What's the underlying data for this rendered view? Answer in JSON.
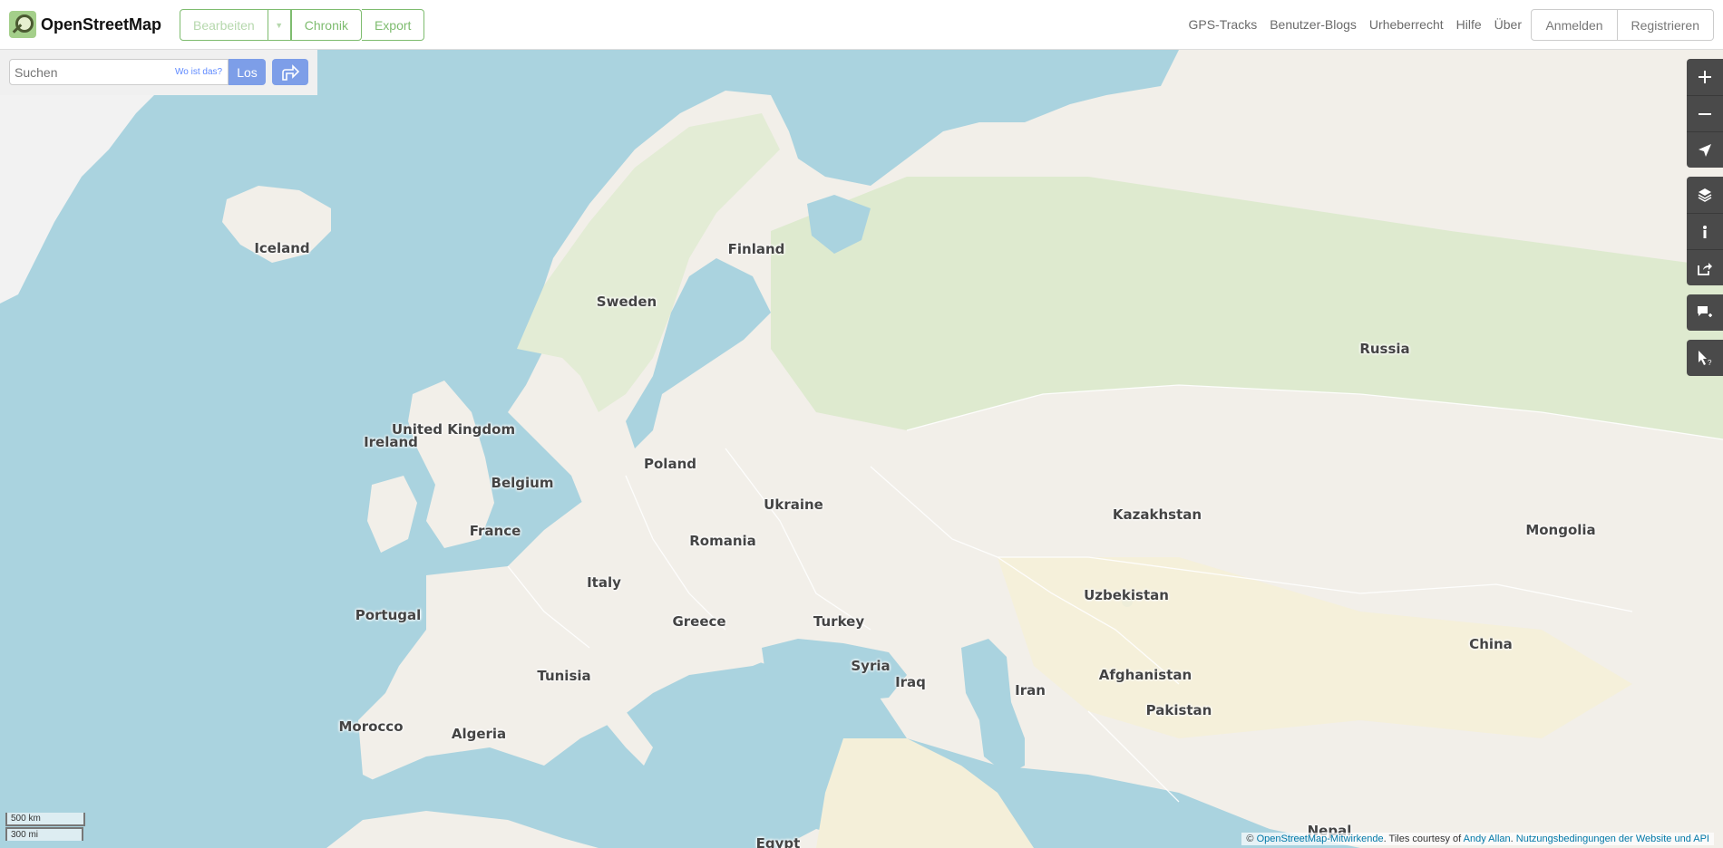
{
  "app": {
    "name": "OpenStreetMap"
  },
  "header": {
    "edit_label": "Bearbeiten",
    "history_label": "Chronik",
    "export_label": "Export",
    "nav": [
      "GPS-Tracks",
      "Benutzer-Blogs",
      "Urheberrecht",
      "Hilfe",
      "Über"
    ],
    "login_label": "Anmelden",
    "register_label": "Registrieren"
  },
  "search": {
    "placeholder": "Suchen",
    "where_label": "Wo ist das?",
    "go_label": "Los",
    "directions_icon": "directions-icon"
  },
  "controls": [
    "zoom-in-icon",
    "zoom-out-icon",
    "locate-icon",
    "layers-icon",
    "info-icon",
    "share-icon",
    "add-note-icon",
    "query-features-icon"
  ],
  "map": {
    "labels": {
      "iceland": "Iceland",
      "finland": "Finland",
      "sweden": "Sweden",
      "russia": "Russia",
      "united_kingdom": "United Kingdom",
      "ireland": "Ireland",
      "poland": "Poland",
      "belgium": "Belgium",
      "ukraine": "Ukraine",
      "kazakhstan": "Kazakhstan",
      "mongolia": "Mongolia",
      "france": "France",
      "romania": "Romania",
      "italy": "Italy",
      "uzbekistan": "Uzbekistan",
      "portugal": "Portugal",
      "greece": "Greece",
      "turkey": "Turkey",
      "china": "China",
      "tunisia": "Tunisia",
      "syria": "Syria",
      "iraq": "Iraq",
      "iran": "Iran",
      "afghanistan": "Afghanistan",
      "morocco": "Morocco",
      "algeria": "Algeria",
      "pakistan": "Pakistan",
      "nepal": "Nepal",
      "egypt": "Egypt"
    },
    "colors": {
      "water": "#aad3df",
      "land": "#f2efe9",
      "forest": "#d3e6c5",
      "arctic": "#f2f2f2"
    }
  },
  "scale": {
    "km": "500 km",
    "mi": "300 mi"
  },
  "attribution": {
    "prefix": "© ",
    "osm_link": "OpenStreetMap-Mitwirkende",
    "middle": ". Tiles courtesy of ",
    "author_link": "Andy Allan",
    "sep": ". ",
    "terms_link": "Nutzungsbedingungen der Website und API"
  }
}
